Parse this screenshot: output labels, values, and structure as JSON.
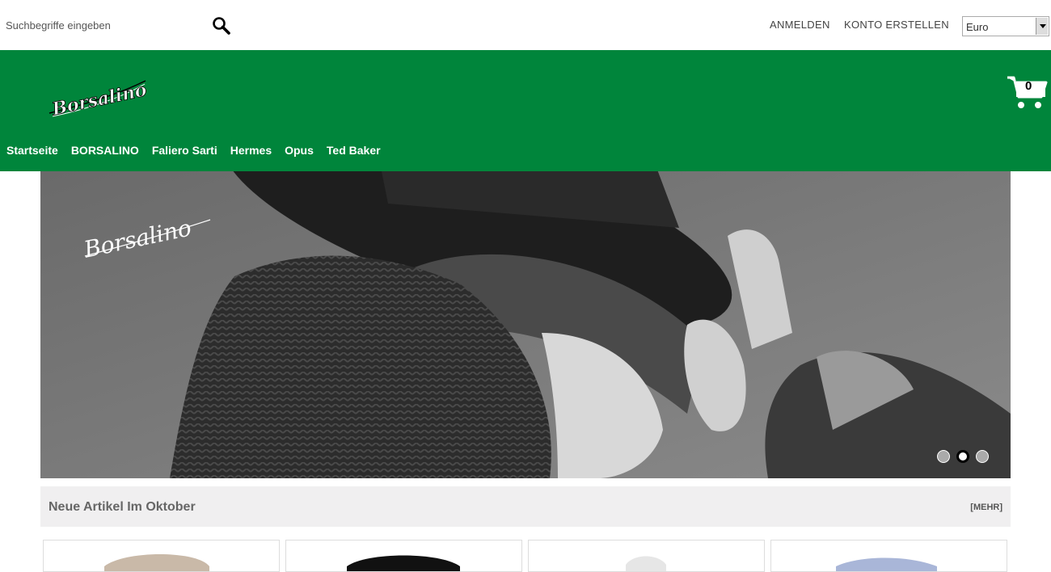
{
  "search": {
    "placeholder": "Suchbegriffe eingeben"
  },
  "account": {
    "login_label": "ANMELDEN",
    "register_label": "KONTO ERSTELLEN"
  },
  "currency": {
    "selected": "Euro"
  },
  "brand": {
    "logo_text": "Borsalino",
    "header_color": "#00853b"
  },
  "cart": {
    "count": "0"
  },
  "nav": {
    "items": [
      {
        "label": "Startseite"
      },
      {
        "label": "BORSALINO"
      },
      {
        "label": "Faliero Sarti"
      },
      {
        "label": "Hermes"
      },
      {
        "label": "Opus"
      },
      {
        "label": "Ted Baker"
      }
    ]
  },
  "hero": {
    "logo_text": "Borsalino",
    "slides": 3,
    "active_slide": 2
  },
  "section": {
    "title": "Neue Artikel Im Oktober",
    "more_label": "[MEHR]"
  },
  "icons": {
    "search": "search-icon",
    "cart": "cart-icon",
    "dropdown": "chevron-down-icon"
  }
}
